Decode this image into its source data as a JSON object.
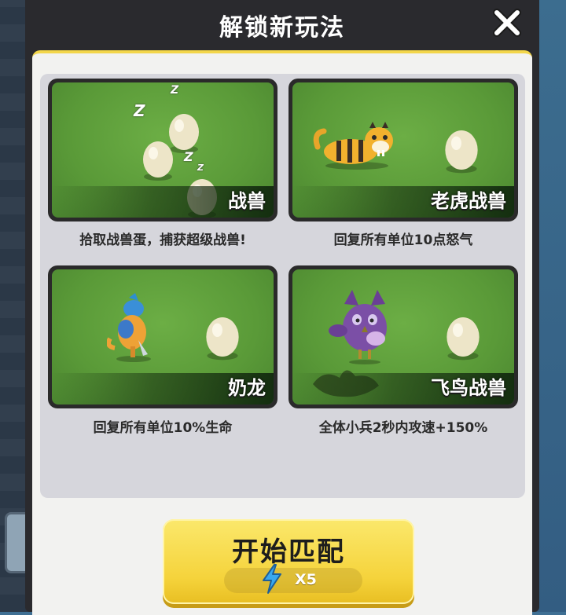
{
  "modal": {
    "title": "解锁新玩法"
  },
  "cards": [
    {
      "label": "战兽",
      "caption": "拾取战兽蛋，捕获超级战兽!"
    },
    {
      "label": "老虎战兽",
      "caption": "回复所有单位10点怒气"
    },
    {
      "label": "奶龙",
      "caption": "回复所有单位10%生命"
    },
    {
      "label": "飞鸟战兽",
      "caption": "全体小兵2秒内攻速+150%"
    }
  ],
  "zzz": [
    "Z",
    "Z",
    "Z",
    "Z"
  ],
  "start_button": {
    "label": "开始匹配",
    "cost": "X5",
    "cost_icon": "lightning-bolt-icon"
  },
  "colors": {
    "accent_yellow": "#f5d33b",
    "card_green": "#5a9a38",
    "modal_dark": "#2a2a2e"
  }
}
